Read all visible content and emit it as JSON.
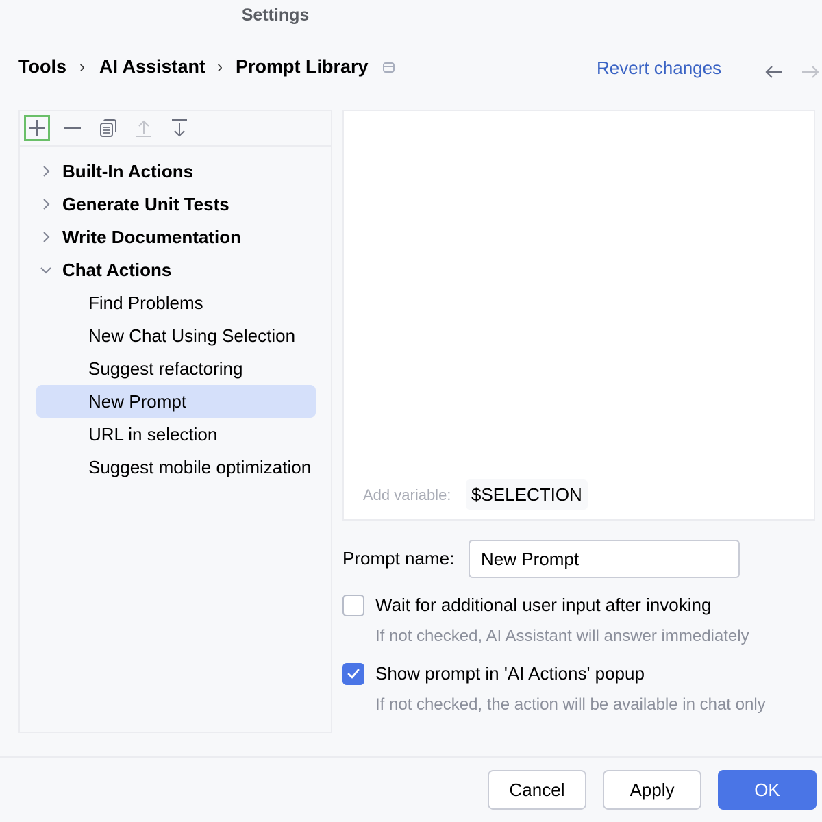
{
  "window": {
    "title": "Settings"
  },
  "breadcrumb": [
    "Tools",
    "AI Assistant",
    "Prompt Library"
  ],
  "header": {
    "revert_label": "Revert changes"
  },
  "toolbar": {
    "icons": [
      "add-icon",
      "remove-icon",
      "copy-icon",
      "move-up-icon",
      "move-down-icon"
    ]
  },
  "tree": {
    "groups": [
      {
        "label": "Built-In Actions",
        "expanded": false
      },
      {
        "label": "Generate Unit Tests",
        "expanded": false
      },
      {
        "label": "Write Documentation",
        "expanded": false
      },
      {
        "label": "Chat Actions",
        "expanded": true
      }
    ],
    "chat_actions": [
      {
        "label": "Find Problems"
      },
      {
        "label": "New Chat Using Selection"
      },
      {
        "label": "Suggest refactoring"
      },
      {
        "label": "New Prompt",
        "selected": true
      },
      {
        "label": "URL in selection"
      },
      {
        "label": "Suggest mobile optimization"
      }
    ]
  },
  "editor": {
    "add_variable_label": "Add variable:",
    "variable": "$SELECTION"
  },
  "form": {
    "prompt_name_label": "Prompt name:",
    "prompt_name_value": "New Prompt",
    "wait_label": "Wait for additional user input after invoking",
    "wait_hint": "If not checked, AI Assistant will answer immediately",
    "wait_checked": false,
    "show_label": "Show prompt in 'AI Actions' popup",
    "show_hint": "If not checked, the action will be available in chat only",
    "show_checked": true
  },
  "footer": {
    "cancel": "Cancel",
    "apply": "Apply",
    "ok": "OK"
  },
  "colors": {
    "accent": "#4a75e6",
    "link": "#3a63c4",
    "selection": "#d5e0fa",
    "focus_ring": "#6abf69"
  }
}
